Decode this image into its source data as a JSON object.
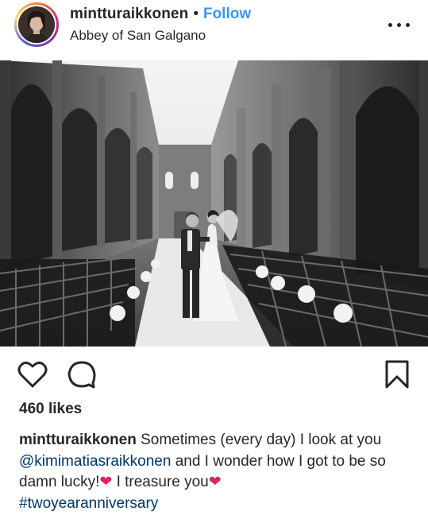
{
  "header": {
    "username": "mintturaikkonen",
    "separator": "•",
    "follow_label": "Follow",
    "location": "Abbey of San Galgano"
  },
  "icons": {
    "more": "more-horizontal-icon",
    "like": "heart-outline-icon",
    "comment": "comment-bubble-icon",
    "save": "bookmark-icon"
  },
  "post": {
    "likes": "460 likes",
    "caption": {
      "username": "mintturaikkonen",
      "text_1": "Sometimes (every day) I look at you",
      "mention": "@kimimatiasraikkonen",
      "text_2": "and I wonder how I got to be so damn lucky!",
      "heart_1": "❤",
      "text_3": "I treasure you",
      "heart_2": "❤",
      "hashtag": "#twoyearanniversary"
    }
  },
  "colors": {
    "link_blue": "#3897f0",
    "mention_blue": "#003569",
    "text": "#262626"
  }
}
